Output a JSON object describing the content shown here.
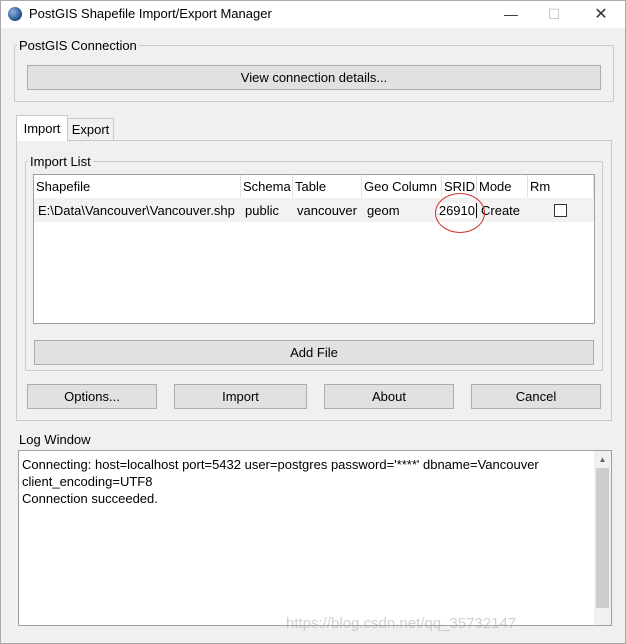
{
  "window": {
    "title": "PostGIS Shapefile Import/Export Manager",
    "minimize": "—",
    "maximize": "☐",
    "close": "✕"
  },
  "connection": {
    "legend": "PostGIS Connection",
    "details_button": "View connection details..."
  },
  "tabs": [
    {
      "label": "Import",
      "active": true
    },
    {
      "label": "Export",
      "active": false
    }
  ],
  "import_list": {
    "legend": "Import List",
    "columns": [
      "Shapefile",
      "Schema",
      "Table",
      "Geo Column",
      "SRID",
      "Mode",
      "Rm"
    ],
    "rows": [
      {
        "shapefile": "E:\\Data\\Vancouver\\Vancouver.shp",
        "schema": "public",
        "table": "vancouver",
        "geo_column": "geom",
        "srid": "26910",
        "mode": "Create",
        "rm": false
      }
    ],
    "add_file_button": "Add File"
  },
  "actions": {
    "options": "Options...",
    "import": "Import",
    "about": "About",
    "cancel": "Cancel"
  },
  "log": {
    "legend": "Log Window",
    "lines": [
      "Connecting:  host=localhost port=5432 user=postgres password='****' dbname=Vancouver client_encoding=UTF8",
      "Connection succeeded."
    ]
  },
  "watermark": "https://blog.csdn.net/qq_35732147",
  "colors": {
    "annotation_circle": "#d03030",
    "button_face": "#e1e1e1",
    "window_bg": "#f0f0f0"
  }
}
